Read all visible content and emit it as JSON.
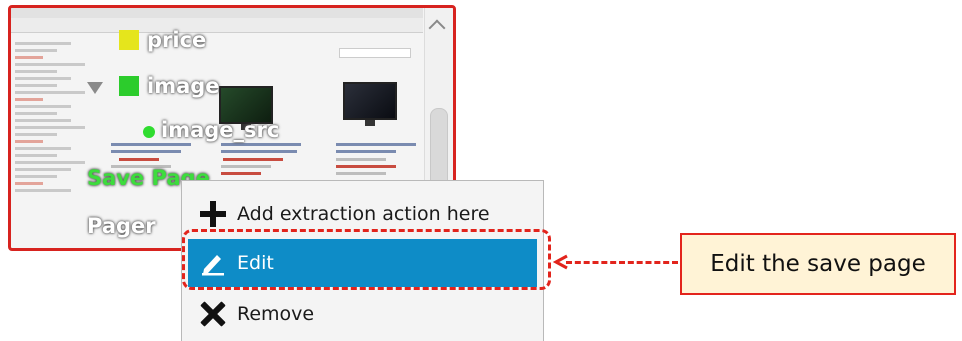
{
  "preview": {
    "selectors": {
      "price": "price",
      "image": "image",
      "image_src": "image_src",
      "save_page": "Save Page",
      "pager": "Pager"
    },
    "selector_colors": {
      "price": "#e5e51c",
      "image": "#2ccc2c",
      "image_src": "#2fdc2f",
      "save_page": "#3ddc3d"
    }
  },
  "context_menu": {
    "items": [
      {
        "label": "Add extraction action here",
        "icon": "plus-icon"
      },
      {
        "label": "Edit",
        "icon": "pencil-icon",
        "selected": true
      },
      {
        "label": "Remove",
        "icon": "x-icon"
      }
    ],
    "selected_color": "#0e8cc7"
  },
  "callout": {
    "text": "Edit the save page",
    "border_color": "#e3241c",
    "background": "#fff3d6"
  }
}
